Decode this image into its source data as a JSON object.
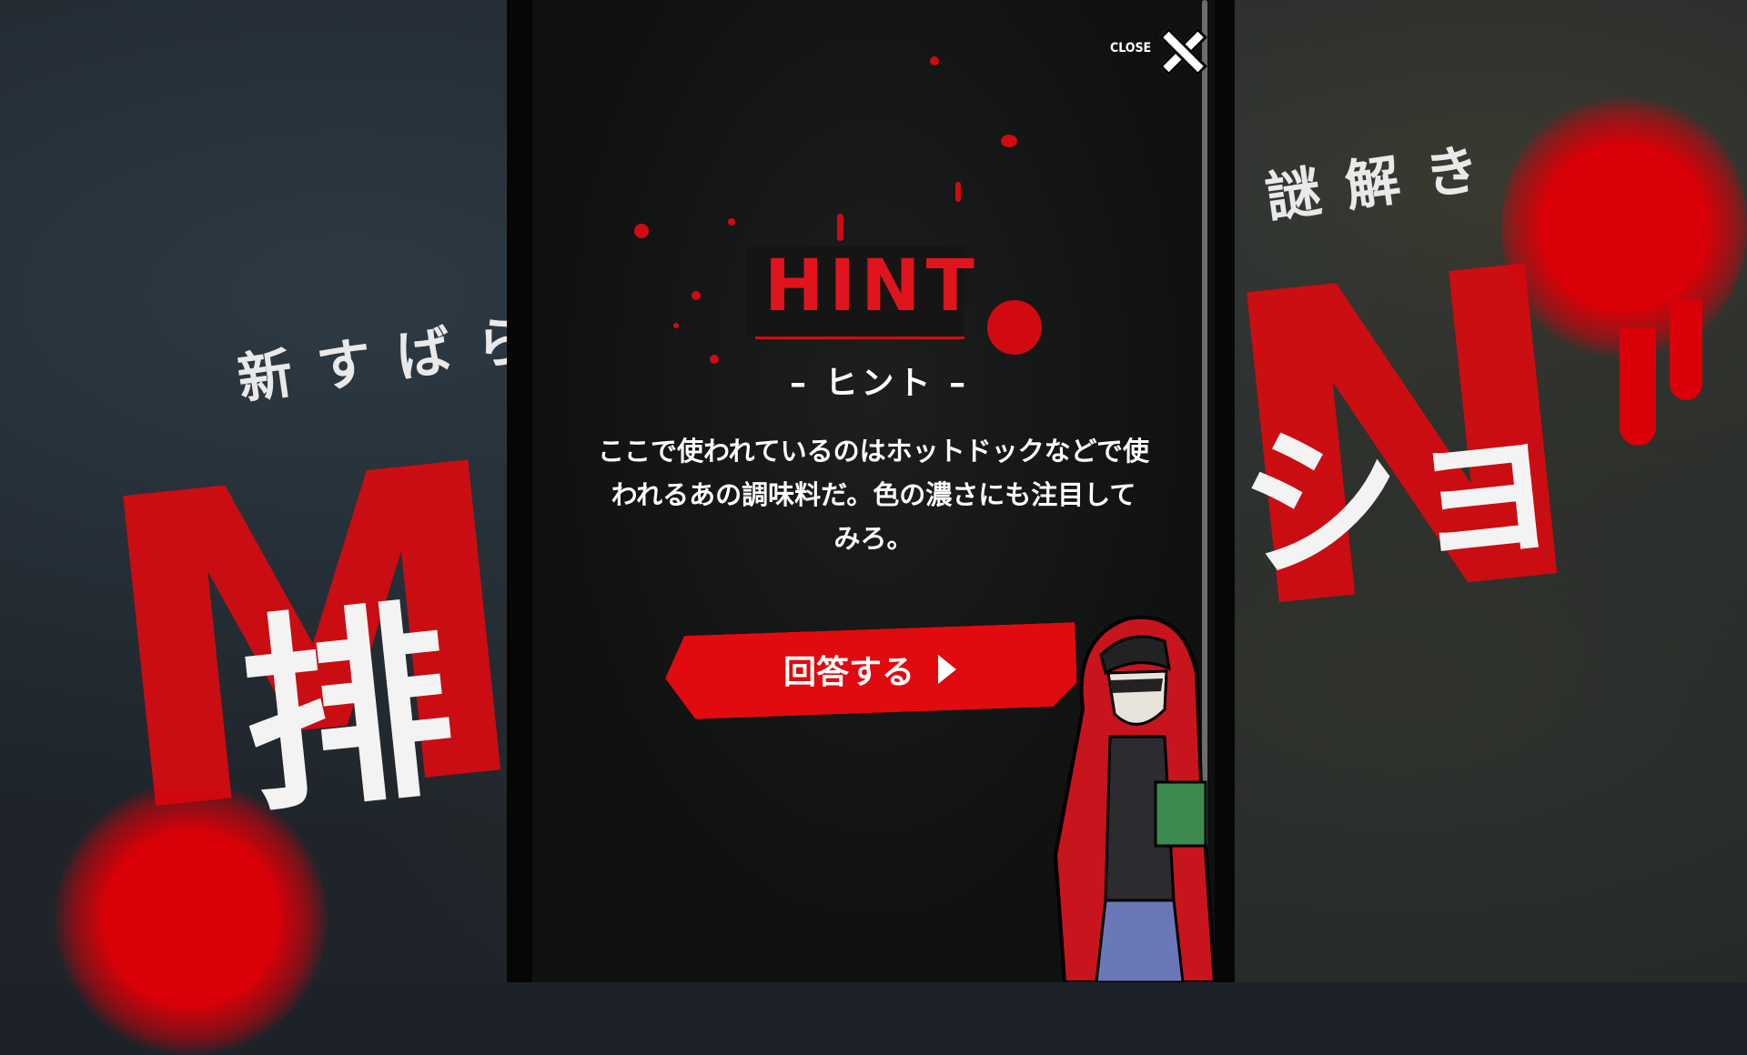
{
  "background": {
    "left_tagline": "新すばら",
    "right_tagline": "謎解き",
    "left_big_glyph": "M",
    "right_big_glyph": "N",
    "left_white_glyph": "排",
    "right_white_glyph": "ショ"
  },
  "modal": {
    "close_label": "CLOSE",
    "hint_title": "HINT",
    "hint_subtitle": "– ヒント –",
    "hint_text_line1": "ここで使われているのはホットドックなどで使",
    "hint_text_line2": "われるあの調味料だ。色の濃さにも注目して",
    "hint_text_line3": "みろ。",
    "answer_button_label": "回答する"
  },
  "colors": {
    "accent_red": "#e00a0f",
    "panel_bg": "#111212",
    "text": "#ffffff"
  }
}
